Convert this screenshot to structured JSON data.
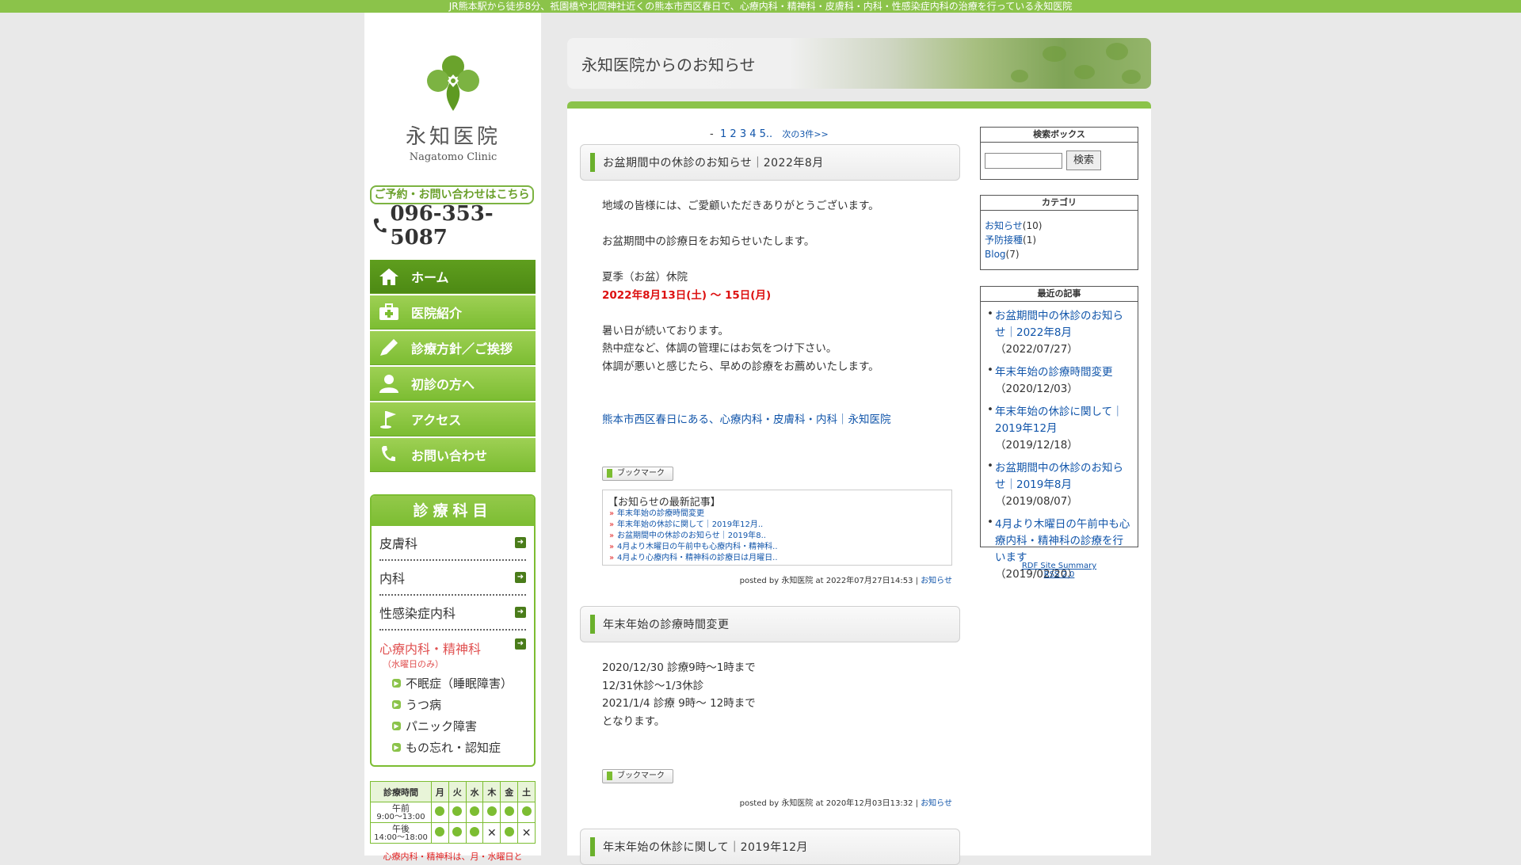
{
  "topbar": {
    "text": "JR熊本駅から徒歩8分、祇園橋や北岡神社近くの熊本市西区春日で、心療内科・精神科・皮膚科・内科・性感染症内科の治療を行っている永知医院"
  },
  "logo": {
    "name": "永知医院",
    "sub": "Nagatomo Clinic"
  },
  "contact": {
    "label": "ご予約・お問い合わせはこちら",
    "phone": "096-353-5087"
  },
  "nav": [
    {
      "label": "ホーム",
      "icon": "home-icon"
    },
    {
      "label": "医院紹介",
      "icon": "medical-kit-icon"
    },
    {
      "label": "診療方針／ご挨拶",
      "icon": "pen-icon"
    },
    {
      "label": "初診の方へ",
      "icon": "person-icon"
    },
    {
      "label": "アクセス",
      "icon": "flag-icon"
    },
    {
      "label": "お問い合わせ",
      "icon": "phone-icon"
    }
  ],
  "departments": {
    "title": "診療科目",
    "items": [
      "皮膚科",
      "内科",
      "性感染症内科"
    ],
    "special": {
      "label": "心療内科・精神科",
      "note": "（水曜日のみ）",
      "subs": [
        "不眠症（睡眠障害）",
        "うつ病",
        "パニック障害",
        "もの忘れ・認知症"
      ]
    }
  },
  "hours": {
    "header": [
      "診療時間",
      "月",
      "火",
      "水",
      "木",
      "金",
      "土"
    ],
    "rows": [
      {
        "label1": "午前",
        "label2": "9:00～13:00",
        "cells": [
          "o",
          "o",
          "o",
          "o",
          "o",
          "o"
        ]
      },
      {
        "label1": "午後",
        "label2": "14:00～18:00",
        "cells": [
          "o",
          "o",
          "o",
          "x",
          "o",
          "x"
        ]
      }
    ],
    "note": "心療内科・精神科は、月・水曜日と"
  },
  "banner": {
    "title": "永知医院からのお知らせ"
  },
  "pager": {
    "dash": "-",
    "pages": [
      "1",
      "2",
      "3",
      "4",
      "5.."
    ],
    "next": "次の3件>>"
  },
  "posts": [
    {
      "title": "お盆期間中の休診のお知らせ｜2022年8月",
      "lines": [
        "地域の皆様には、ご愛顧いただきありがとうございます。",
        "",
        "お盆期間中の診療日をお知らせいたします。",
        "",
        "夏季（お盆）休院"
      ],
      "highlight": "2022年8月13日(土) ～ 15日(月)",
      "lines2": [
        "",
        "暑い日が続いております。",
        "熱中症など、体調の管理にはお気をつけ下さい。",
        "体調が悪いと感じたら、早めの診療をお薦めいたします。"
      ],
      "link": "熊本市西区春日にある、心療内科・皮膚科・内科｜永知医院",
      "bookmark": "ブックマーク",
      "recent_title": "【お知らせの最新記事】",
      "recent": [
        "年末年始の診療時間変更",
        "年末年始の休診に関して｜2019年12月..",
        "お盆期間中の休診のお知らせ｜2019年8..",
        "4月より木曜日の午前中も心療内科・精神科..",
        "4月より心療内科・精神科の診療日は月曜日.."
      ],
      "posted": "posted by 永知医院 at 2022年07月27日14:53 |",
      "category": "お知らせ"
    },
    {
      "title": "年末年始の診療時間変更",
      "lines": [
        "2020/12/30 診療9時～1時まで",
        "12/31休診～1/3休診",
        "2021/1/4 診療 9時～ 12時まで",
        "となります。"
      ],
      "bookmark": "ブックマーク",
      "posted": "posted by 永知医院 at 2020年12月03日13:32 |",
      "category": "お知らせ"
    },
    {
      "title": "年末年始の休診に関して｜2019年12月"
    }
  ],
  "sidebar": {
    "search": {
      "title": "検索ボックス",
      "button": "検索",
      "value": ""
    },
    "categories": {
      "title": "カテゴリ",
      "items": [
        {
          "name": "お知らせ",
          "count": "(10)"
        },
        {
          "name": "予防接種",
          "count": "(1)"
        },
        {
          "name": "Blog",
          "count": "(7)"
        }
      ]
    },
    "recent": {
      "title": "最近の記事",
      "items": [
        {
          "title": "お盆期間中の休診のお知らせ｜2022年8月",
          "date": "（2022/07/27）"
        },
        {
          "title": "年末年始の診療時間変更",
          "date": "（2020/12/03）"
        },
        {
          "title": "年末年始の休診に関して｜2019年12月",
          "date": "（2019/12/18）"
        },
        {
          "title": "お盆期間中の休診のお知らせ｜2019年8月",
          "date": "（2019/08/07）"
        },
        {
          "title": "4月より木曜日の午前中も心療内科・精神科の診療を行います",
          "date": "（2019/02/20）"
        }
      ]
    },
    "rdf": "RDF Site Summary",
    "rss": "RSS 2.0"
  },
  "colors": {
    "accent": "#8bc34a",
    "nav_active": "#4d8a14",
    "link": "#1155aa",
    "alert": "#dd1111"
  }
}
